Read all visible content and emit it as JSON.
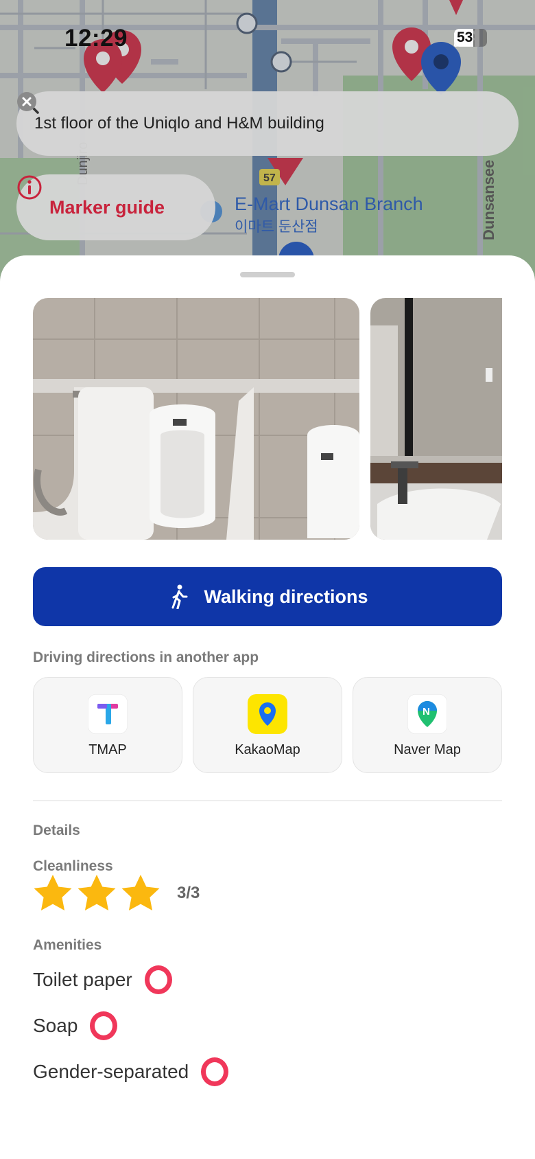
{
  "status_bar": {
    "time": "12:29",
    "battery": "53"
  },
  "search": {
    "query": "1st floor of the Uniqlo and H&M building"
  },
  "marker_guide": {
    "label": "Marker guide"
  },
  "map_labels": {
    "place_en": "E-Mart Dunsan Branch",
    "place_ko": "이마트 둔산점",
    "road_left": "Dunjiro",
    "road_right": "Dunsansee",
    "route_badge": "57"
  },
  "actions": {
    "walking_directions": "Walking directions"
  },
  "driving": {
    "label": "Driving directions in another app",
    "apps": [
      {
        "name": "TMAP",
        "icon": "tmap-icon"
      },
      {
        "name": "KakaoMap",
        "icon": "kakaomap-icon"
      },
      {
        "name": "Naver Map",
        "icon": "naver-map-icon"
      }
    ]
  },
  "details": {
    "label": "Details",
    "cleanliness": {
      "label": "Cleanliness",
      "rating": 3,
      "max": 3,
      "text": "3/3"
    },
    "amenities": {
      "label": "Amenities",
      "items": [
        {
          "name": "Toilet paper",
          "available": true
        },
        {
          "name": "Soap",
          "available": true
        },
        {
          "name": "Gender-separated",
          "available": true
        }
      ]
    }
  },
  "colors": {
    "primary": "#0f36a8",
    "marker_red": "#c8233c",
    "available_mark": "#f0375a",
    "star": "#fbb80f"
  }
}
